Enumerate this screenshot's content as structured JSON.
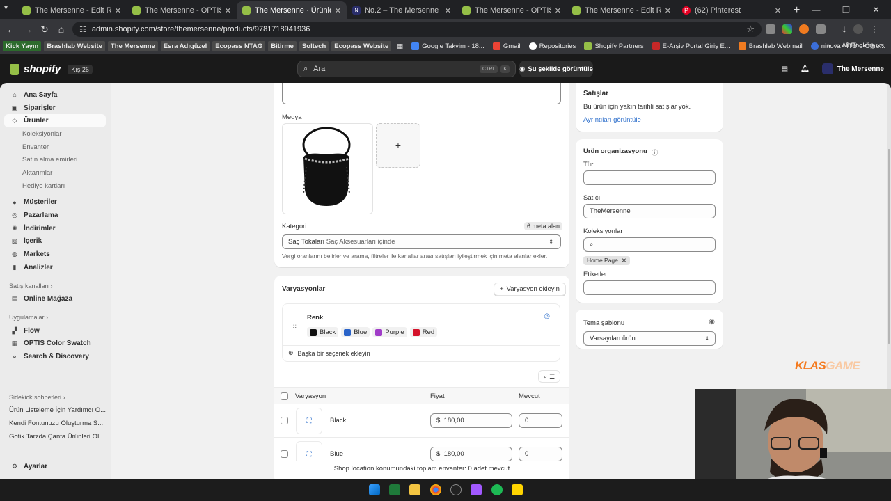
{
  "browser": {
    "tabs": [
      {
        "title": "The Mersenne - Edit Rise - Shop",
        "icon": "shopify-icon",
        "active": false
      },
      {
        "title": "The Mersenne - OPTIS Color Sw",
        "icon": "shopify-icon",
        "active": false
      },
      {
        "title": "The Mersenne · Ürünler · No.2",
        "icon": "shopify-icon",
        "active": true
      },
      {
        "title": "No.2 – The Mersenne",
        "icon": "mersenne-icon",
        "active": false
      },
      {
        "title": "The Mersenne - OPTIS Color Sw",
        "icon": "shopify-icon",
        "active": false
      },
      {
        "title": "The Mersenne - Edit Rise - Shop",
        "icon": "shopify-icon",
        "active": false
      },
      {
        "title": "(62) Pinterest",
        "icon": "pinterest-icon",
        "active": false
      }
    ],
    "url": "admin.shopify.com/store/themersenne/products/9781718941936",
    "bookmarks": [
      "Kick Yayın",
      "Brashlab Website",
      "The Mersenne",
      "Esra Adıgüzel",
      "Ecopass NTAG",
      "Bitirme",
      "Soltech",
      "Ecopass Website",
      "Google Takvim - 18...",
      "Gmail",
      "Repositories",
      "Shopify Partners",
      "E-Arşiv Portal Giriş E...",
      "Brashlab Webmail",
      "ninova - İTÜ e-Öğre..."
    ],
    "all_bookmarks": "All Bookmarks"
  },
  "shopbar": {
    "logo": "shopify",
    "badge": "Kış 26",
    "search_placeholder": "Ara",
    "kbd1": "CTRL",
    "kbd2": "K",
    "view_button": "Şu şekilde görüntüle",
    "store_name": "The Mersenne"
  },
  "sidebar": {
    "items": [
      {
        "label": "Ana Sayfa",
        "icon": "home-icon"
      },
      {
        "label": "Siparişler",
        "icon": "inbox-icon"
      },
      {
        "label": "Ürünler",
        "icon": "tag-icon"
      },
      {
        "label": "Müşteriler",
        "icon": "person-icon"
      },
      {
        "label": "Pazarlama",
        "icon": "target-icon"
      },
      {
        "label": "İndirimler",
        "icon": "discount-icon"
      },
      {
        "label": "İçerik",
        "icon": "content-icon"
      },
      {
        "label": "Markets",
        "icon": "globe-icon"
      },
      {
        "label": "Analizler",
        "icon": "chart-icon"
      }
    ],
    "subitems": [
      "Koleksiyonlar",
      "Envanter",
      "Satın alma emirleri",
      "Aktarımlar",
      "Hediye kartları"
    ],
    "sales_channels_label": "Satış kanalları",
    "online_store": "Online Mağaza",
    "apps_label": "Uygulamalar",
    "apps": [
      "Flow",
      "OPTIS Color Swatch",
      "Search & Discovery"
    ],
    "sidekick_label": "Sidekick sohbetleri",
    "sidekick_items": [
      "Ürün Listeleme İçin Yardımcı O...",
      "Kendi Fontunuzu Oluşturma S...",
      "Gotik Tarzda Çanta Ürünleri Ol..."
    ],
    "settings": "Ayarlar"
  },
  "product": {
    "media_label": "Medya",
    "category_label": "Kategori",
    "meta_fields": "6 meta alan",
    "category_value": "Saç Tokaları",
    "category_path": "Saç Aksesuarları içinde",
    "category_help": "Vergi oranlarını belirler ve arama, filtreler ile kanallar arası satışları iyileştirmek için meta alanlar ekler."
  },
  "variants": {
    "title": "Varyasyonlar",
    "add_button": "Varyasyon ekleyin",
    "option_name": "Renk",
    "values": [
      {
        "name": "Black",
        "color": "#111111"
      },
      {
        "name": "Blue",
        "color": "#2b64c9"
      },
      {
        "name": "Purple",
        "color": "#a03cc8"
      },
      {
        "name": "Red",
        "color": "#d4122a"
      }
    ],
    "add_option": "Başka bir seçenek ekleyin",
    "columns": [
      "Varyasyon",
      "Fiyat",
      "Mevcut"
    ],
    "rows": [
      {
        "name": "Black",
        "currency": "$",
        "price": "180,00",
        "available": "0"
      },
      {
        "name": "Blue",
        "currency": "$",
        "price": "180,00",
        "available": "0"
      }
    ],
    "inventory_note": "Shop location konumundaki toplam envanter: 0 adet mevcut"
  },
  "right": {
    "sales_title": "Satışlar",
    "sales_text": "Bu ürün için yakın tarihli satışlar yok.",
    "sales_link": "Ayrıntıları görüntüle",
    "org_title": "Ürün organizasyonu",
    "type_label": "Tür",
    "type_value": "",
    "vendor_label": "Satıcı",
    "vendor_value": "TheMersenne",
    "collections_label": "Koleksiyonlar",
    "collection_tag": "Home Page",
    "tags_label": "Etiketler",
    "template_label": "Tema şablonu",
    "template_value": "Varsayılan ürün"
  },
  "overlay": {
    "watermark_a": "KLAS",
    "watermark_b": "GAME"
  }
}
